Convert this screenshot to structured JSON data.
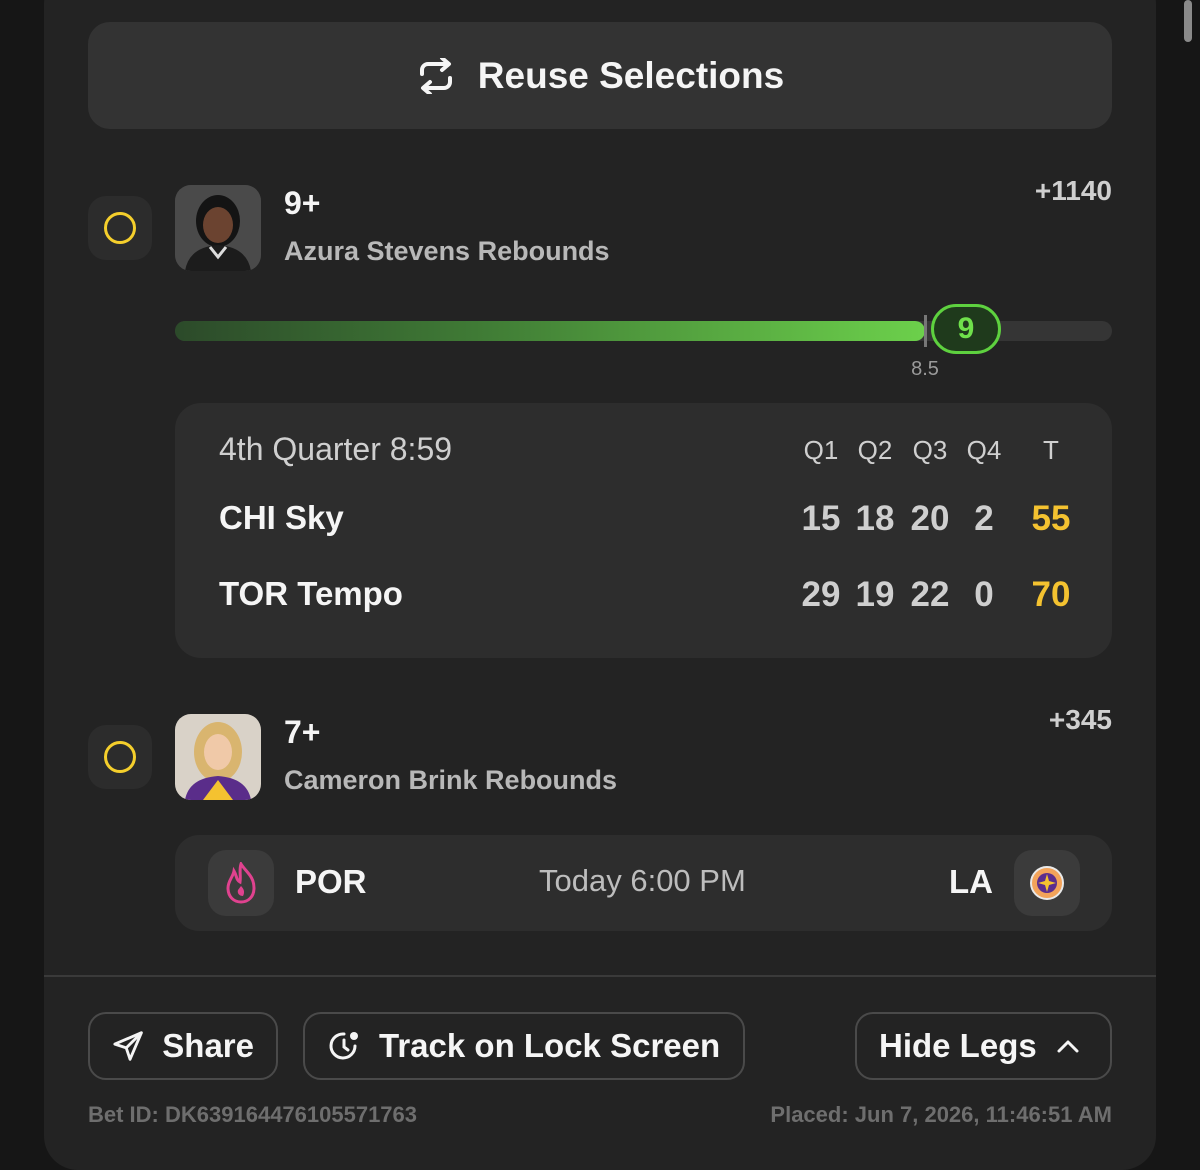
{
  "reuse": {
    "label": "Reuse Selections",
    "icon": "repeat-icon"
  },
  "legs": [
    {
      "line": "9+",
      "market": "Azura Stevens Rebounds",
      "odds": "+1140",
      "progress": {
        "current": "9",
        "threshold": "8.5",
        "fraction": 0.8
      },
      "score": {
        "status": "4th Quarter 8:59",
        "headers": [
          "Q1",
          "Q2",
          "Q3",
          "Q4",
          "T"
        ],
        "teams": [
          {
            "name": "CHI Sky",
            "quarters": [
              "15",
              "18",
              "20",
              "2"
            ],
            "total": "55"
          },
          {
            "name": "TOR Tempo",
            "quarters": [
              "29",
              "19",
              "22",
              "0"
            ],
            "total": "70"
          }
        ]
      }
    },
    {
      "line": "7+",
      "market": "Cameron Brink Rebounds",
      "odds": "+345",
      "game": {
        "away": "POR",
        "time": "Today 6:00 PM",
        "home": "LA"
      }
    }
  ],
  "actions": {
    "share": "Share",
    "track": "Track on Lock Screen",
    "hide_legs": "Hide Legs"
  },
  "footer": {
    "bet_id": "Bet ID: DK639164476105571763",
    "placed": "Placed: Jun 7, 2026, 11:46:51 AM"
  },
  "colors": {
    "accent_yellow": "#f5cf2c",
    "progress_green": "#6cd04b",
    "total_gold": "#f4c230"
  }
}
